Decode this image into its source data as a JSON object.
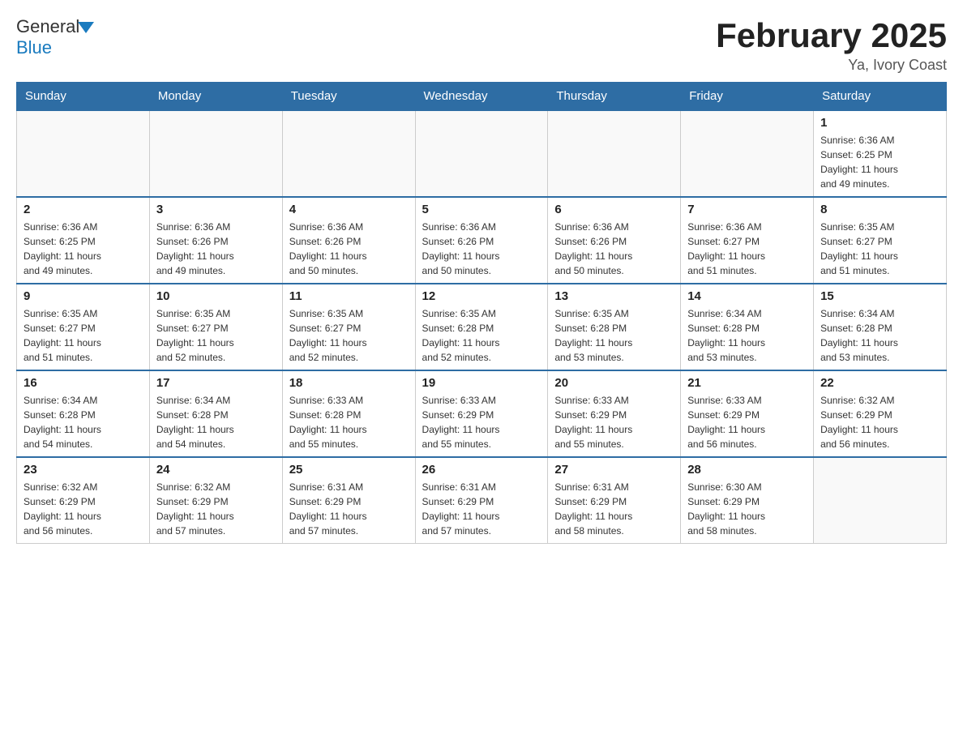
{
  "header": {
    "logo_general": "General",
    "logo_blue": "Blue",
    "month_title": "February 2025",
    "location": "Ya, Ivory Coast"
  },
  "days_of_week": [
    "Sunday",
    "Monday",
    "Tuesday",
    "Wednesday",
    "Thursday",
    "Friday",
    "Saturday"
  ],
  "weeks": [
    [
      {
        "day": "",
        "info": ""
      },
      {
        "day": "",
        "info": ""
      },
      {
        "day": "",
        "info": ""
      },
      {
        "day": "",
        "info": ""
      },
      {
        "day": "",
        "info": ""
      },
      {
        "day": "",
        "info": ""
      },
      {
        "day": "1",
        "info": "Sunrise: 6:36 AM\nSunset: 6:25 PM\nDaylight: 11 hours\nand 49 minutes."
      }
    ],
    [
      {
        "day": "2",
        "info": "Sunrise: 6:36 AM\nSunset: 6:25 PM\nDaylight: 11 hours\nand 49 minutes."
      },
      {
        "day": "3",
        "info": "Sunrise: 6:36 AM\nSunset: 6:26 PM\nDaylight: 11 hours\nand 49 minutes."
      },
      {
        "day": "4",
        "info": "Sunrise: 6:36 AM\nSunset: 6:26 PM\nDaylight: 11 hours\nand 50 minutes."
      },
      {
        "day": "5",
        "info": "Sunrise: 6:36 AM\nSunset: 6:26 PM\nDaylight: 11 hours\nand 50 minutes."
      },
      {
        "day": "6",
        "info": "Sunrise: 6:36 AM\nSunset: 6:26 PM\nDaylight: 11 hours\nand 50 minutes."
      },
      {
        "day": "7",
        "info": "Sunrise: 6:36 AM\nSunset: 6:27 PM\nDaylight: 11 hours\nand 51 minutes."
      },
      {
        "day": "8",
        "info": "Sunrise: 6:35 AM\nSunset: 6:27 PM\nDaylight: 11 hours\nand 51 minutes."
      }
    ],
    [
      {
        "day": "9",
        "info": "Sunrise: 6:35 AM\nSunset: 6:27 PM\nDaylight: 11 hours\nand 51 minutes."
      },
      {
        "day": "10",
        "info": "Sunrise: 6:35 AM\nSunset: 6:27 PM\nDaylight: 11 hours\nand 52 minutes."
      },
      {
        "day": "11",
        "info": "Sunrise: 6:35 AM\nSunset: 6:27 PM\nDaylight: 11 hours\nand 52 minutes."
      },
      {
        "day": "12",
        "info": "Sunrise: 6:35 AM\nSunset: 6:28 PM\nDaylight: 11 hours\nand 52 minutes."
      },
      {
        "day": "13",
        "info": "Sunrise: 6:35 AM\nSunset: 6:28 PM\nDaylight: 11 hours\nand 53 minutes."
      },
      {
        "day": "14",
        "info": "Sunrise: 6:34 AM\nSunset: 6:28 PM\nDaylight: 11 hours\nand 53 minutes."
      },
      {
        "day": "15",
        "info": "Sunrise: 6:34 AM\nSunset: 6:28 PM\nDaylight: 11 hours\nand 53 minutes."
      }
    ],
    [
      {
        "day": "16",
        "info": "Sunrise: 6:34 AM\nSunset: 6:28 PM\nDaylight: 11 hours\nand 54 minutes."
      },
      {
        "day": "17",
        "info": "Sunrise: 6:34 AM\nSunset: 6:28 PM\nDaylight: 11 hours\nand 54 minutes."
      },
      {
        "day": "18",
        "info": "Sunrise: 6:33 AM\nSunset: 6:28 PM\nDaylight: 11 hours\nand 55 minutes."
      },
      {
        "day": "19",
        "info": "Sunrise: 6:33 AM\nSunset: 6:29 PM\nDaylight: 11 hours\nand 55 minutes."
      },
      {
        "day": "20",
        "info": "Sunrise: 6:33 AM\nSunset: 6:29 PM\nDaylight: 11 hours\nand 55 minutes."
      },
      {
        "day": "21",
        "info": "Sunrise: 6:33 AM\nSunset: 6:29 PM\nDaylight: 11 hours\nand 56 minutes."
      },
      {
        "day": "22",
        "info": "Sunrise: 6:32 AM\nSunset: 6:29 PM\nDaylight: 11 hours\nand 56 minutes."
      }
    ],
    [
      {
        "day": "23",
        "info": "Sunrise: 6:32 AM\nSunset: 6:29 PM\nDaylight: 11 hours\nand 56 minutes."
      },
      {
        "day": "24",
        "info": "Sunrise: 6:32 AM\nSunset: 6:29 PM\nDaylight: 11 hours\nand 57 minutes."
      },
      {
        "day": "25",
        "info": "Sunrise: 6:31 AM\nSunset: 6:29 PM\nDaylight: 11 hours\nand 57 minutes."
      },
      {
        "day": "26",
        "info": "Sunrise: 6:31 AM\nSunset: 6:29 PM\nDaylight: 11 hours\nand 57 minutes."
      },
      {
        "day": "27",
        "info": "Sunrise: 6:31 AM\nSunset: 6:29 PM\nDaylight: 11 hours\nand 58 minutes."
      },
      {
        "day": "28",
        "info": "Sunrise: 6:30 AM\nSunset: 6:29 PM\nDaylight: 11 hours\nand 58 minutes."
      },
      {
        "day": "",
        "info": ""
      }
    ]
  ]
}
